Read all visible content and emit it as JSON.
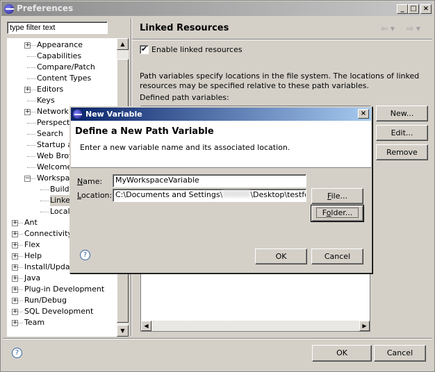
{
  "window": {
    "title": "Preferences",
    "icon": "eclipse-icon",
    "controls": [
      "minimize",
      "maximize",
      "close"
    ]
  },
  "filter": {
    "placeholder": "type filter text"
  },
  "tree": {
    "children": [
      {
        "label": "Appearance",
        "expandable": true
      },
      {
        "label": "Capabilities"
      },
      {
        "label": "Compare/Patch"
      },
      {
        "label": "Content Types"
      },
      {
        "label": "Editors",
        "expandable": true
      },
      {
        "label": "Keys"
      },
      {
        "label": "Network C",
        "expandable": true
      },
      {
        "label": "Perspecti"
      },
      {
        "label": "Search"
      },
      {
        "label": "Startup a"
      },
      {
        "label": "Web Brow"
      },
      {
        "label": "Welcome"
      },
      {
        "label": "Workspace",
        "expanded": true
      }
    ],
    "grandchildren": [
      {
        "label": "Build"
      },
      {
        "label": "Linked",
        "selected": true
      },
      {
        "label": "Local"
      }
    ],
    "top": [
      "Ant",
      "Connectivity",
      "Flex",
      "Help",
      "Install/Update",
      "Java",
      "Plug-in Development",
      "Run/Debug",
      "SQL Development",
      "Team"
    ]
  },
  "page": {
    "title": "Linked Resources",
    "enable_label": "Enable linked resources",
    "enable_checked": true,
    "description": "Path variables specify locations in the file system. The locations of linked resources may be specified relative to these path variables.",
    "defined_label": "Defined path variables:",
    "buttons": {
      "new": "New...",
      "edit": "Edit...",
      "remove": "Remove"
    }
  },
  "footer": {
    "ok": "OK",
    "cancel": "Cancel"
  },
  "dialog": {
    "title": "New Variable",
    "heading": "Define a New Path Variable",
    "message": "Enter a new variable name and its associated location.",
    "name_label": "Name:",
    "name_value": "MyWorkspaceVariable",
    "location_label": "Location:",
    "location_value_a": "C:\\Documents and Settings\\",
    "location_value_b": "\\Desktop\\testfolder",
    "file_btn": "File...",
    "folder_btn": "Folder...",
    "ok": "OK",
    "cancel": "Cancel"
  },
  "colors": {
    "dialog_title": "#0a246a",
    "selection": "#d4d0c8"
  }
}
